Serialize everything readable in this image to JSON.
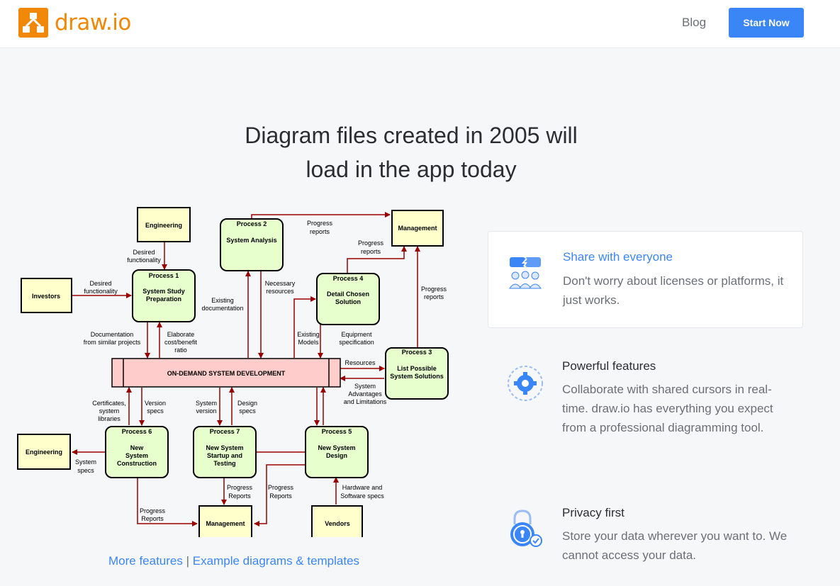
{
  "header": {
    "logo_text": "draw.io",
    "blog_label": "Blog",
    "start_label": "Start Now"
  },
  "hero": {
    "headline_line1": "Diagram files created in 2005 will",
    "headline_line2": "load in the app today"
  },
  "diagram": {
    "nodes": {
      "engineering_top": "Engineering",
      "investors": "Investors",
      "process1_title": "Process 1",
      "process1_body1": "System Study",
      "process1_body2": "Preparation",
      "process2_title": "Process 2",
      "process2_body": "System Analysis",
      "management_top": "Management",
      "process4_title": "Process 4",
      "process4_body1": "Detail Chosen",
      "process4_body2": "Solution",
      "process3_title": "Process 3",
      "process3_body1": "List Possible",
      "process3_body2": "System Solutions",
      "central": "ON-DEMAND SYSTEM DEVELOPMENT",
      "engineering_left": "Engineering",
      "process6_title": "Process 6",
      "process6_body1": "New",
      "process6_body2": "System",
      "process6_body3": "Construction",
      "process7_title": "Process 7",
      "process7_body1": "New System",
      "process7_body2": "Startup and",
      "process7_body3": "Testing",
      "process5_title": "Process 5",
      "process5_body1": "New System",
      "process5_body2": "Design",
      "management_bottom": "Management",
      "vendors": "Vendors"
    },
    "labels": {
      "desired_func_1a": "Desired",
      "desired_func_1b": "functionality",
      "desired_func_2a": "Desired",
      "desired_func_2b": "functionality",
      "progress_reports_top_a": "Progress",
      "progress_reports_top_b": "reports",
      "progress_reports_p4_a": "Progress",
      "progress_reports_p4_b": "reports",
      "progress_reports_p3_a": "Progress",
      "progress_reports_p3_b": "reports",
      "existing_doc_a": "Existing",
      "existing_doc_b": "documentation",
      "necessary_res_a": "Necessary",
      "necessary_res_b": "resources",
      "doc_similar_a": "Documentation",
      "doc_similar_b": "from similar projects",
      "elaborate_a": "Elaborate",
      "elaborate_b": "cost/benefit",
      "elaborate_c": "ratio",
      "existing_models_a": "Existing",
      "existing_models_b": "Models",
      "equipment_a": "Equipment",
      "equipment_b": "specification",
      "resources": "Resources",
      "sys_adv_a": "System",
      "sys_adv_b": "Advantages",
      "sys_adv_c": "and Limitations",
      "certificates_a": "Certificates,",
      "certificates_b": "system",
      "certificates_c": "libraries",
      "version_specs_a": "Version",
      "version_specs_b": "specs",
      "system_version_a": "System",
      "system_version_b": "version",
      "design_specs_a": "Design",
      "design_specs_b": "specs",
      "system_specs_a": "System",
      "system_specs_b": "specs",
      "progress_p7_a": "Progress",
      "progress_p7_b": "Reports",
      "progress_p5_a": "Progress",
      "progress_p5_b": "Reports",
      "progress_p6_a": "Progress",
      "progress_p6_b": "Reports",
      "hardware_a": "Hardware and",
      "hardware_b": "Software specs"
    }
  },
  "links": {
    "more_features": "More features",
    "separator": "|",
    "examples": "Example diagrams & templates"
  },
  "features": [
    {
      "title": "Share with everyone",
      "desc": "Don't worry about licenses or platforms, it just works.",
      "icon": "share-people-icon"
    },
    {
      "title": "Powerful features",
      "desc": "Collaborate with shared cursors in real-time. draw.io has everything you expect from a professional diagramming tool.",
      "icon": "gear-sync-icon"
    },
    {
      "title": "Privacy first",
      "desc": "Store your data wherever you want to. We cannot access your data.",
      "icon": "padlock-icon"
    }
  ],
  "colors": {
    "brand_orange": "#f08705",
    "accent_blue": "#3b86f7",
    "process_fill": "#e6ffcc",
    "entity_fill": "#ffffcc",
    "central_fill": "#ffcccc",
    "arrow_color": "#990000"
  }
}
